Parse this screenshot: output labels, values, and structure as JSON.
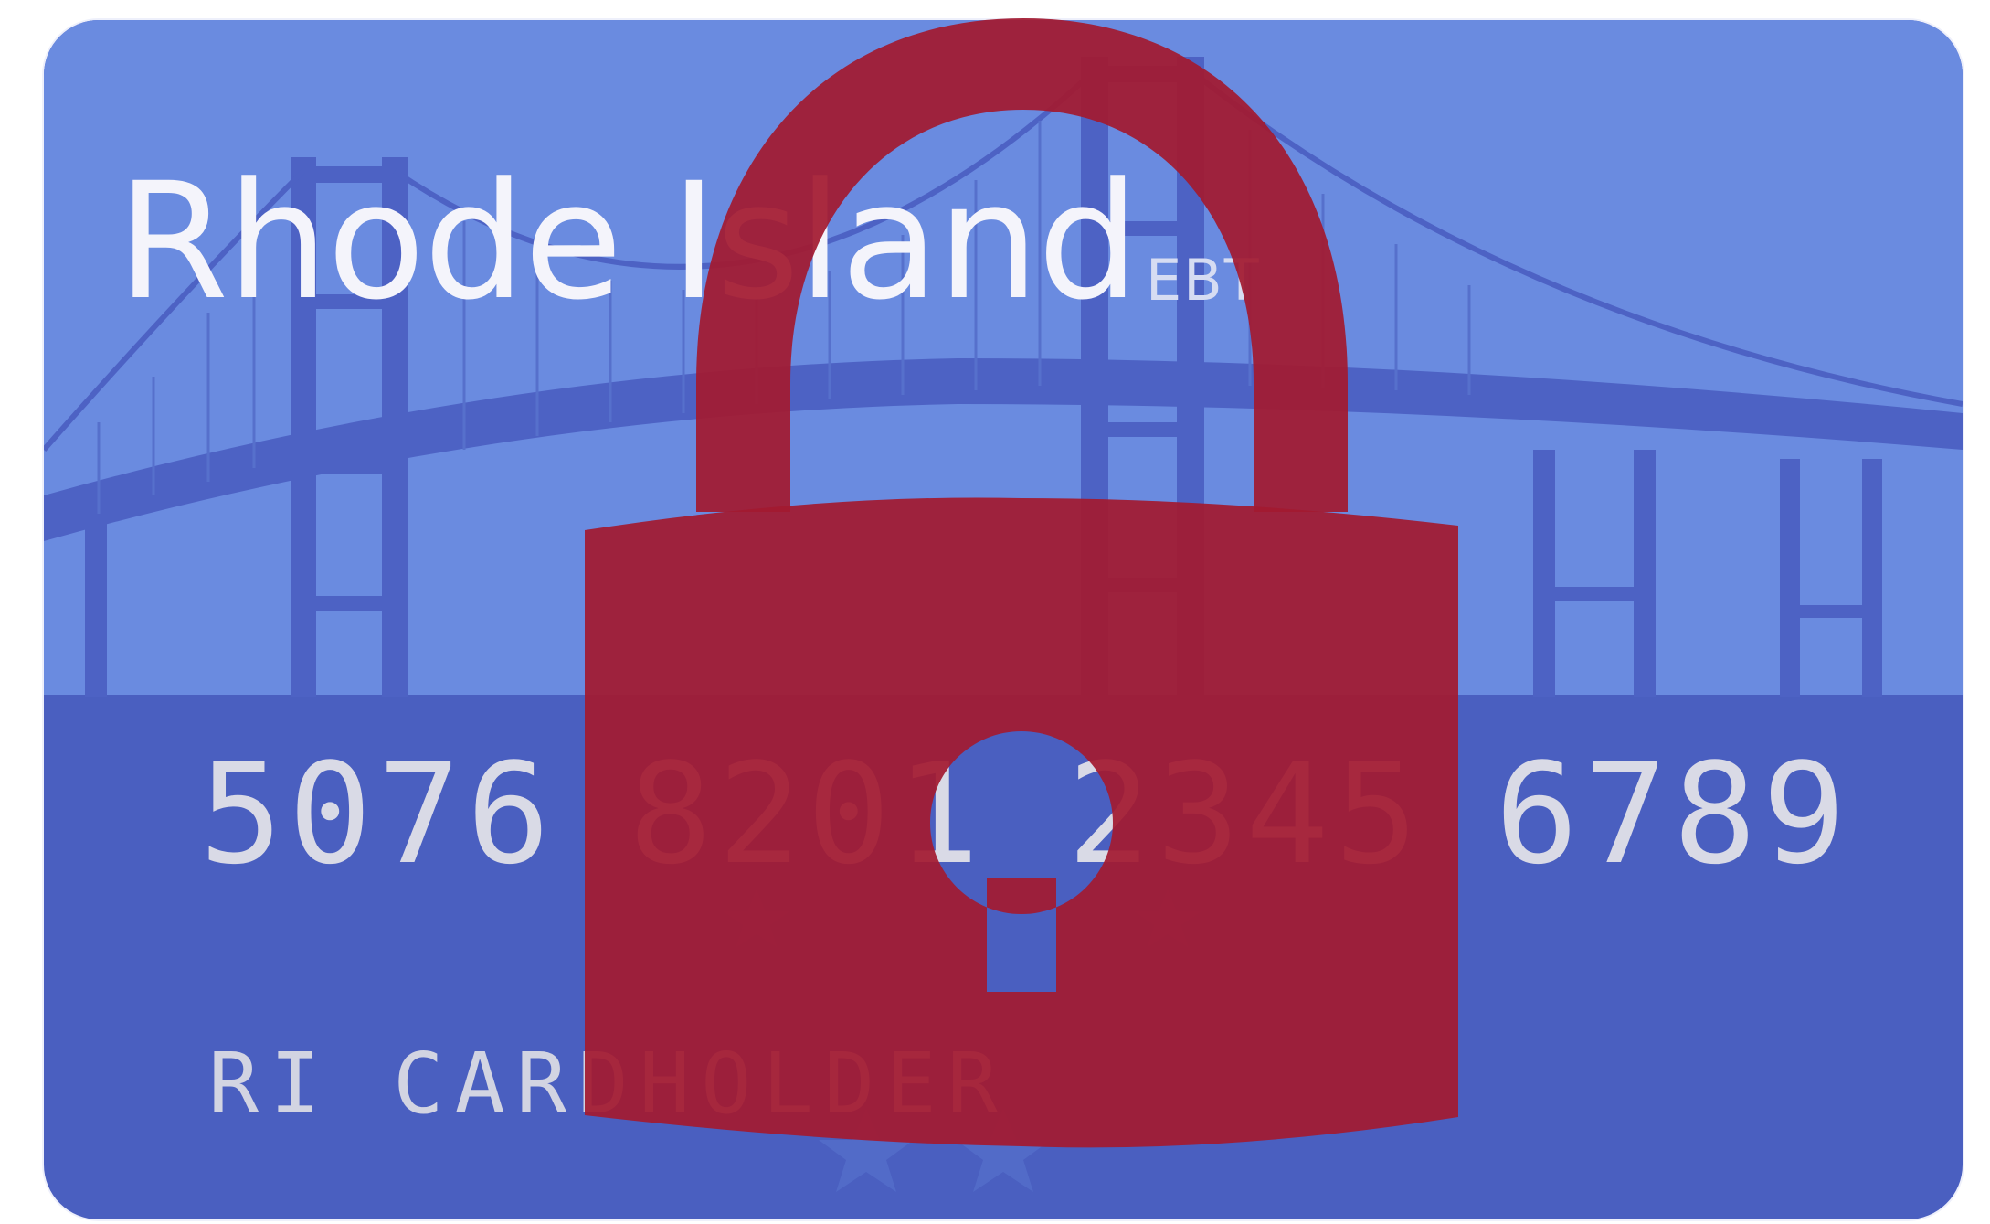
{
  "card": {
    "state_name": "Rhode Island",
    "program": "EBT",
    "number_groups": [
      "5076",
      "8201",
      "2345",
      "6789"
    ],
    "holder": "RI CARDHOLDER"
  },
  "colors": {
    "sky": "#6a8be0",
    "card_base": "#4a5fc0",
    "bridge": "#4a5fc0",
    "lock": "#a31a30",
    "text_light": "#f4f4fb"
  },
  "overlay_icon": "padlock-icon"
}
